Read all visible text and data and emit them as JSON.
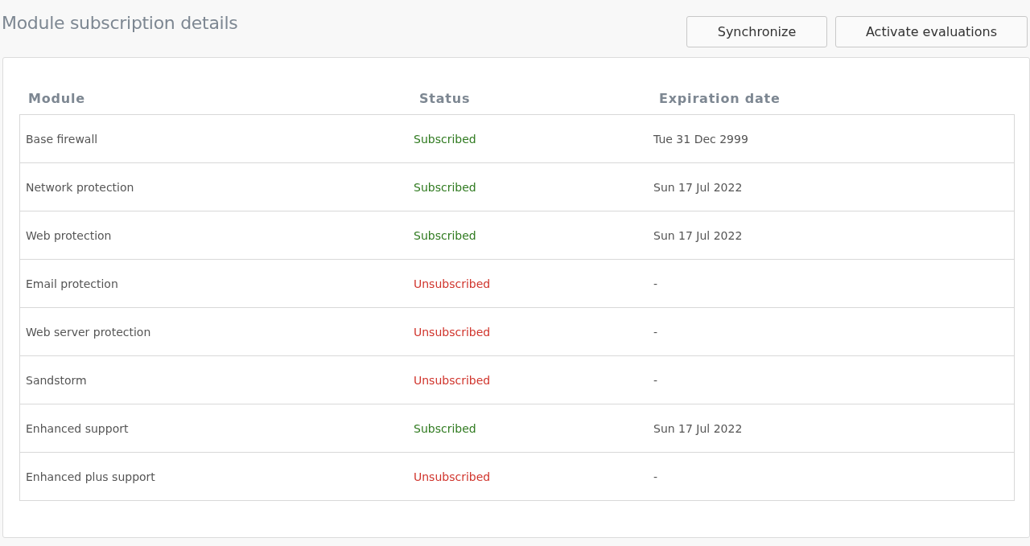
{
  "title": "Module subscription details",
  "buttons": [
    "Synchronize",
    "Activate evaluations"
  ],
  "table": {
    "columns": [
      "Module",
      "Status",
      "Expiration date"
    ],
    "rows": [
      {
        "module": "Base firewall",
        "status": {
          "text": "Subscribed",
          "kind": "subscribed"
        },
        "expiration": "Tue 31 Dec 2999"
      },
      {
        "module": "Network protection",
        "status": {
          "text": "Subscribed",
          "kind": "subscribed"
        },
        "expiration": "Sun 17 Jul 2022"
      },
      {
        "module": "Web protection",
        "status": {
          "text": "Subscribed",
          "kind": "subscribed"
        },
        "expiration": "Sun 17 Jul 2022"
      },
      {
        "module": "Email protection",
        "status": {
          "text": "Unsubscribed",
          "kind": "unsubscribed"
        },
        "expiration": "-"
      },
      {
        "module": "Web server protection",
        "status": {
          "text": "Unsubscribed",
          "kind": "unsubscribed"
        },
        "expiration": "-"
      },
      {
        "module": "Sandstorm",
        "status": {
          "text": "Unsubscribed",
          "kind": "unsubscribed"
        },
        "expiration": "-"
      },
      {
        "module": "Enhanced support",
        "status": {
          "text": "Subscribed",
          "kind": "subscribed"
        },
        "expiration": "Sun 17 Jul 2022"
      },
      {
        "module": "Enhanced plus support",
        "status": {
          "text": "Unsubscribed",
          "kind": "unsubscribed"
        },
        "expiration": "-"
      }
    ]
  }
}
